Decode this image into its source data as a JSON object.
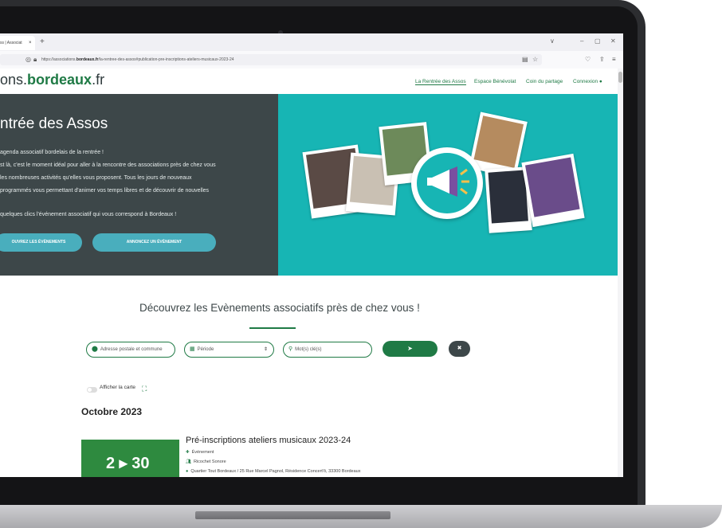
{
  "browser": {
    "tab_title": "ss | Associat",
    "tab_close": "×",
    "new_tab": "+",
    "url_prefix": "https://associations.",
    "url_domain": "bordeaux.fr",
    "url_suffix": "/la-rentree-des-assos#publication-pre-inscriptions-ateliers-musicaux-2023-24",
    "window_controls": [
      "∨",
      "–",
      "▢",
      "✕"
    ]
  },
  "site": {
    "logo_prefix": "ons.",
    "logo_brand": "bordeaux",
    "logo_suffix": ".fr",
    "nav": [
      {
        "label": "La Rentrée des Assos"
      },
      {
        "label": "Espace Bénévolat"
      },
      {
        "label": "Coin du partage"
      },
      {
        "label": "Connexion"
      }
    ]
  },
  "hero": {
    "title": "ntrée des Assos",
    "lines": [
      "agenda associatif bordelais de la rentrée !",
      "st là, c'est le moment idéal pour aller à la rencontre des associations près de chez vous",
      "les nombreuses activités qu'elles vous proposent. Tous les jours de nouveaux",
      "programmés vous permettant d'animer vos temps libres et de découvrir de nouvelles",
      "quelques clics l'événement associatif qui vous correspond à Bordeaux !"
    ],
    "btn_discover": "OUVREZ LES ÉVÈNEMENTS",
    "btn_announce": "ANNONCEZ UN ÉVÈNEMENT"
  },
  "search": {
    "title": "Découvrez les Evènements associatifs près de chez vous !",
    "address_placeholder": "Adresse postale et commune",
    "period_label": "Période",
    "keywords_placeholder": "Mot(s) clé(s)",
    "toggle_label": "Afficher la carte"
  },
  "listing": {
    "month": "Octobre 2023",
    "event": {
      "date": "2 ▸ 30",
      "title": "Pré-inscriptions ateliers musicaux 2023-24",
      "type": "Événement",
      "organizer": "Ricochet Sonore",
      "location": "Quartier Tout Bordeaux / 25 Rue Marcel Pagnol, Résidence Concert'ô, 33300 Bordeaux"
    }
  },
  "colors": {
    "brand_green": "#1f7a45",
    "hero_dark": "#3d4749",
    "hero_teal": "#17b5b4",
    "button_blue": "#49aebd"
  }
}
